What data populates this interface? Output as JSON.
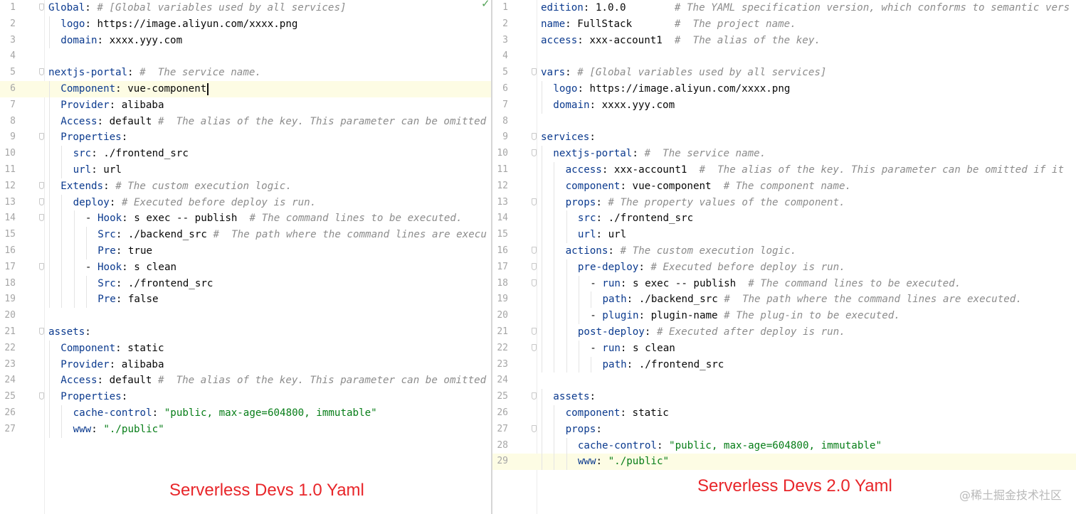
{
  "left": {
    "caption": "Serverless Devs 1.0 Yaml",
    "check_icon": "✓",
    "current_line": 6,
    "lines": [
      {
        "n": "1",
        "i": 0,
        "p": [
          [
            "k",
            "Global"
          ],
          [
            "t",
            ": "
          ],
          [
            "c",
            "# [Global variables used by all services]"
          ]
        ]
      },
      {
        "n": "2",
        "i": 1,
        "p": [
          [
            "k",
            "logo"
          ],
          [
            "t",
            ": https://image.aliyun.com/xxxx.png"
          ]
        ]
      },
      {
        "n": "3",
        "i": 1,
        "p": [
          [
            "k",
            "domain"
          ],
          [
            "t",
            ": xxxx.yyy.com"
          ]
        ]
      },
      {
        "n": "4",
        "i": 0,
        "p": []
      },
      {
        "n": "5",
        "i": 0,
        "p": [
          [
            "k",
            "nextjs-portal"
          ],
          [
            "t",
            ": "
          ],
          [
            "c",
            "#  The service name."
          ]
        ]
      },
      {
        "n": "6",
        "i": 1,
        "p": [
          [
            "k",
            "Component"
          ],
          [
            "t",
            ": vue-component"
          ]
        ]
      },
      {
        "n": "7",
        "i": 1,
        "p": [
          [
            "k",
            "Provider"
          ],
          [
            "t",
            ": alibaba"
          ]
        ]
      },
      {
        "n": "8",
        "i": 1,
        "p": [
          [
            "k",
            "Access"
          ],
          [
            "t",
            ": default "
          ],
          [
            "c",
            "#  The alias of the key. This parameter can be omitted"
          ]
        ]
      },
      {
        "n": "9",
        "i": 1,
        "p": [
          [
            "k",
            "Properties"
          ],
          [
            "t",
            ":"
          ]
        ]
      },
      {
        "n": "10",
        "i": 2,
        "p": [
          [
            "k",
            "src"
          ],
          [
            "t",
            ": ./frontend_src"
          ]
        ]
      },
      {
        "n": "11",
        "i": 2,
        "p": [
          [
            "k",
            "url"
          ],
          [
            "t",
            ": url"
          ]
        ]
      },
      {
        "n": "12",
        "i": 1,
        "p": [
          [
            "k",
            "Extends"
          ],
          [
            "t",
            ": "
          ],
          [
            "c",
            "# The custom execution logic."
          ]
        ]
      },
      {
        "n": "13",
        "i": 2,
        "p": [
          [
            "k",
            "deploy"
          ],
          [
            "t",
            ": "
          ],
          [
            "c",
            "# Executed before deploy is run."
          ]
        ]
      },
      {
        "n": "14",
        "i": 3,
        "p": [
          [
            "t",
            "- "
          ],
          [
            "k",
            "Hook"
          ],
          [
            "t",
            ": s exec -- publish  "
          ],
          [
            "c",
            "# The command lines to be executed."
          ]
        ]
      },
      {
        "n": "15",
        "i": 4,
        "p": [
          [
            "k",
            "Src"
          ],
          [
            "t",
            ": ./backend_src "
          ],
          [
            "c",
            "#  The path where the command lines are execu"
          ]
        ]
      },
      {
        "n": "16",
        "i": 4,
        "p": [
          [
            "k",
            "Pre"
          ],
          [
            "t",
            ": true"
          ]
        ]
      },
      {
        "n": "17",
        "i": 3,
        "p": [
          [
            "t",
            "- "
          ],
          [
            "k",
            "Hook"
          ],
          [
            "t",
            ": s clean"
          ]
        ]
      },
      {
        "n": "18",
        "i": 4,
        "p": [
          [
            "k",
            "Src"
          ],
          [
            "t",
            ": ./frontend_src"
          ]
        ]
      },
      {
        "n": "19",
        "i": 4,
        "p": [
          [
            "k",
            "Pre"
          ],
          [
            "t",
            ": false"
          ]
        ]
      },
      {
        "n": "20",
        "i": 0,
        "p": []
      },
      {
        "n": "21",
        "i": 0,
        "p": [
          [
            "k",
            "assets"
          ],
          [
            "t",
            ":"
          ]
        ]
      },
      {
        "n": "22",
        "i": 1,
        "p": [
          [
            "k",
            "Component"
          ],
          [
            "t",
            ": static"
          ]
        ]
      },
      {
        "n": "23",
        "i": 1,
        "p": [
          [
            "k",
            "Provider"
          ],
          [
            "t",
            ": alibaba"
          ]
        ]
      },
      {
        "n": "24",
        "i": 1,
        "p": [
          [
            "k",
            "Access"
          ],
          [
            "t",
            ": default "
          ],
          [
            "c",
            "#  The alias of the key. This parameter can be omitted"
          ]
        ]
      },
      {
        "n": "25",
        "i": 1,
        "p": [
          [
            "k",
            "Properties"
          ],
          [
            "t",
            ":"
          ]
        ]
      },
      {
        "n": "26",
        "i": 2,
        "p": [
          [
            "k",
            "cache-control"
          ],
          [
            "t",
            ": "
          ],
          [
            "s",
            "\"public, max-age=604800, immutable\""
          ]
        ]
      },
      {
        "n": "27",
        "i": 2,
        "p": [
          [
            "k",
            "www"
          ],
          [
            "t",
            ": "
          ],
          [
            "s",
            "\"./public\""
          ]
        ]
      }
    ]
  },
  "right": {
    "caption": "Serverless Devs 2.0 Yaml",
    "current_line": 29,
    "lines": [
      {
        "n": "1",
        "i": 0,
        "p": [
          [
            "k",
            "edition"
          ],
          [
            "t",
            ": 1.0.0        "
          ],
          [
            "c",
            "# The YAML specification version, which conforms to semantic vers"
          ]
        ]
      },
      {
        "n": "2",
        "i": 0,
        "p": [
          [
            "k",
            "name"
          ],
          [
            "t",
            ": FullStack       "
          ],
          [
            "c",
            "#  The project name."
          ]
        ]
      },
      {
        "n": "3",
        "i": 0,
        "p": [
          [
            "k",
            "access"
          ],
          [
            "t",
            ": xxx-account1  "
          ],
          [
            "c",
            "#  The alias of the key."
          ]
        ]
      },
      {
        "n": "4",
        "i": 0,
        "p": []
      },
      {
        "n": "5",
        "i": 0,
        "p": [
          [
            "k",
            "vars"
          ],
          [
            "t",
            ": "
          ],
          [
            "c",
            "# [Global variables used by all services]"
          ]
        ]
      },
      {
        "n": "6",
        "i": 1,
        "p": [
          [
            "k",
            "logo"
          ],
          [
            "t",
            ": https://image.aliyun.com/xxxx.png"
          ]
        ]
      },
      {
        "n": "7",
        "i": 1,
        "p": [
          [
            "k",
            "domain"
          ],
          [
            "t",
            ": xxxx.yyy.com"
          ]
        ]
      },
      {
        "n": "8",
        "i": 0,
        "p": []
      },
      {
        "n": "9",
        "i": 0,
        "p": [
          [
            "k",
            "services"
          ],
          [
            "t",
            ":"
          ]
        ]
      },
      {
        "n": "10",
        "i": 1,
        "p": [
          [
            "k",
            "nextjs-portal"
          ],
          [
            "t",
            ": "
          ],
          [
            "c",
            "#  The service name."
          ]
        ]
      },
      {
        "n": "11",
        "i": 2,
        "p": [
          [
            "k",
            "access"
          ],
          [
            "t",
            ": xxx-account1  "
          ],
          [
            "c",
            "#  The alias of the key. This parameter can be omitted if it"
          ]
        ]
      },
      {
        "n": "12",
        "i": 2,
        "p": [
          [
            "k",
            "component"
          ],
          [
            "t",
            ": vue-component  "
          ],
          [
            "c",
            "# The component name."
          ]
        ]
      },
      {
        "n": "13",
        "i": 2,
        "p": [
          [
            "k",
            "props"
          ],
          [
            "t",
            ": "
          ],
          [
            "c",
            "# The property values of the component."
          ]
        ]
      },
      {
        "n": "14",
        "i": 3,
        "p": [
          [
            "k",
            "src"
          ],
          [
            "t",
            ": ./frontend_src"
          ]
        ]
      },
      {
        "n": "15",
        "i": 3,
        "p": [
          [
            "k",
            "url"
          ],
          [
            "t",
            ": url"
          ]
        ]
      },
      {
        "n": "16",
        "i": 2,
        "p": [
          [
            "k",
            "actions"
          ],
          [
            "t",
            ": "
          ],
          [
            "c",
            "# The custom execution logic."
          ]
        ]
      },
      {
        "n": "17",
        "i": 3,
        "p": [
          [
            "k",
            "pre-deploy"
          ],
          [
            "t",
            ": "
          ],
          [
            "c",
            "# Executed before deploy is run."
          ]
        ]
      },
      {
        "n": "18",
        "i": 4,
        "p": [
          [
            "t",
            "- "
          ],
          [
            "k",
            "run"
          ],
          [
            "t",
            ": s exec -- publish  "
          ],
          [
            "c",
            "# The command lines to be executed."
          ]
        ]
      },
      {
        "n": "19",
        "i": 5,
        "p": [
          [
            "k",
            "path"
          ],
          [
            "t",
            ": ./backend_src "
          ],
          [
            "c",
            "#  The path where the command lines are executed."
          ]
        ]
      },
      {
        "n": "20",
        "i": 4,
        "p": [
          [
            "t",
            "- "
          ],
          [
            "k",
            "plugin"
          ],
          [
            "t",
            ": plugin-name "
          ],
          [
            "c",
            "# The plug-in to be executed."
          ]
        ]
      },
      {
        "n": "21",
        "i": 3,
        "p": [
          [
            "k",
            "post-deploy"
          ],
          [
            "t",
            ": "
          ],
          [
            "c",
            "# Executed after deploy is run."
          ]
        ]
      },
      {
        "n": "22",
        "i": 4,
        "p": [
          [
            "t",
            "- "
          ],
          [
            "k",
            "run"
          ],
          [
            "t",
            ": s clean"
          ]
        ]
      },
      {
        "n": "23",
        "i": 5,
        "p": [
          [
            "k",
            "path"
          ],
          [
            "t",
            ": ./frontend_src"
          ]
        ]
      },
      {
        "n": "24",
        "i": 0,
        "p": []
      },
      {
        "n": "25",
        "i": 1,
        "p": [
          [
            "k",
            "assets"
          ],
          [
            "t",
            ":"
          ]
        ]
      },
      {
        "n": "26",
        "i": 2,
        "p": [
          [
            "k",
            "component"
          ],
          [
            "t",
            ": static"
          ]
        ]
      },
      {
        "n": "27",
        "i": 2,
        "p": [
          [
            "k",
            "props"
          ],
          [
            "t",
            ":"
          ]
        ]
      },
      {
        "n": "28",
        "i": 3,
        "p": [
          [
            "k",
            "cache-control"
          ],
          [
            "t",
            ": "
          ],
          [
            "s",
            "\"public, max-age=604800, immutable\""
          ]
        ]
      },
      {
        "n": "29",
        "i": 3,
        "p": [
          [
            "k",
            "www"
          ],
          [
            "t",
            ": "
          ],
          [
            "s",
            "\"./public\""
          ]
        ]
      }
    ]
  },
  "watermark": "@稀土掘金技术社区"
}
